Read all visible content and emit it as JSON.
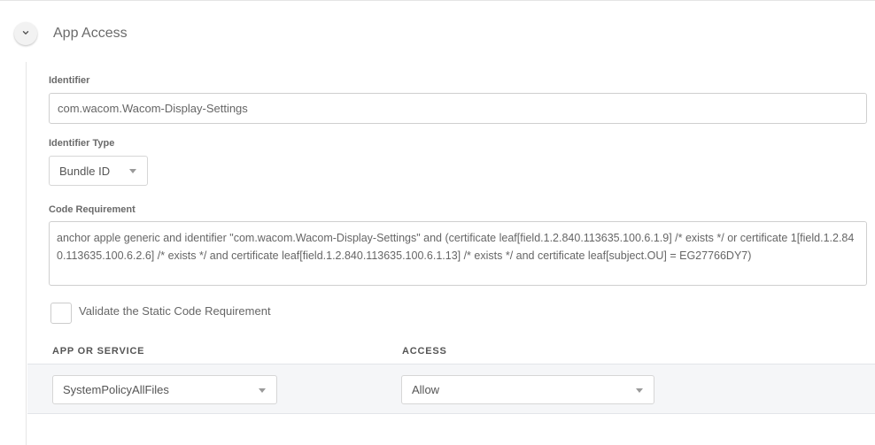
{
  "section": {
    "title": "App Access"
  },
  "identifier": {
    "label": "Identifier",
    "value": "com.wacom.Wacom-Display-Settings"
  },
  "identifier_type": {
    "label": "Identifier Type",
    "selected": "Bundle ID"
  },
  "code_requirement": {
    "label": "Code Requirement",
    "value": "anchor apple generic and identifier \"com.wacom.Wacom-Display-Settings\" and (certificate leaf[field.1.2.840.113635.100.6.1.9] /* exists */ or certificate 1[field.1.2.840.113635.100.6.2.6] /* exists */ and certificate leaf[field.1.2.840.113635.100.6.1.13] /* exists */ and certificate leaf[subject.OU] = EG27766DY7)"
  },
  "validate": {
    "label": "Validate the Static Code Requirement",
    "checked": false
  },
  "table": {
    "columns": [
      "APP OR SERVICE",
      "ACCESS"
    ],
    "rows": [
      {
        "app_or_service": "SystemPolicyAllFiles",
        "access": "Allow"
      }
    ]
  },
  "icons": {
    "collapse": "chevron-down-icon",
    "dropdown": "caret-down-icon"
  },
  "colors": {
    "row_background": "#f5f6f8",
    "border": "#cfcfcf",
    "label": "#6a6a6a"
  }
}
